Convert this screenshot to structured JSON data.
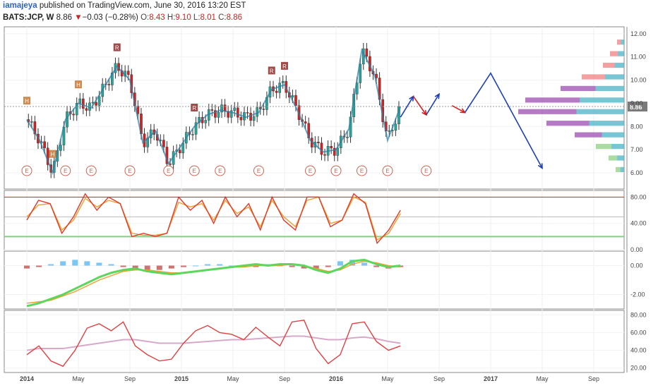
{
  "header": {
    "author": "iamajeya",
    "published_text": "published on TradingView.com, June 30, 2016 13:20 EST",
    "symbol": "BATS:JCP, W",
    "price": "8.86",
    "change_arrow": "▼",
    "change": "−0.03 (−0.28%)",
    "open_label": "O:",
    "open": "8.43",
    "high_label": "H:",
    "high": "9.10",
    "low_label": "L:",
    "low": "8.01",
    "close_label": "C:",
    "close": "8.86"
  },
  "colors": {
    "up": "#26a69a",
    "down": "#d62020",
    "projection_blue": "#1f3fb8",
    "projection_red": "#d62020",
    "volume_profile_purple": "#9b4fb0",
    "volume_profile_teal": "#4bb3c4",
    "volume_profile_pink": "#f08080",
    "volume_profile_green": "#8ed081",
    "stoch_k": "#e03a2a",
    "stoch_d": "#f0a030",
    "band_upper": "#d62020",
    "band_lower": "#7cd47c"
  },
  "chart_data": [
    {
      "type": "candlestick",
      "pane": "price",
      "symbol": "BATS:JCP",
      "interval": "W",
      "x_ticks": [
        "2014",
        "May",
        "Sep",
        "2015",
        "May",
        "Sep",
        "2016",
        "May",
        "Sep",
        "2017",
        "May",
        "Sep"
      ],
      "ylim": [
        5.3,
        12.3
      ],
      "y_ticks": [
        6.0,
        7.0,
        8.0,
        9.0,
        10.0,
        11.0,
        12.0
      ],
      "last_price": 8.86,
      "close_path": [
        [
          "2014-01",
          8.3
        ],
        [
          "2014-02",
          7.4
        ],
        [
          "2014-03",
          6.0
        ],
        [
          "2014-04",
          8.3
        ],
        [
          "2014-05",
          9.0
        ],
        [
          "2014-06",
          8.8
        ],
        [
          "2014-07",
          9.7
        ],
        [
          "2014-08",
          10.6
        ],
        [
          "2014-09",
          10.0
        ],
        [
          "2014-10",
          7.3
        ],
        [
          "2014-11",
          7.8
        ],
        [
          "2014-12",
          6.4
        ],
        [
          "2015-01",
          7.2
        ],
        [
          "2015-02",
          8.0
        ],
        [
          "2015-03",
          8.5
        ],
        [
          "2015-04",
          8.7
        ],
        [
          "2015-05",
          8.6
        ],
        [
          "2015-06",
          8.4
        ],
        [
          "2015-07",
          8.6
        ],
        [
          "2015-08",
          9.6
        ],
        [
          "2015-09",
          9.8
        ],
        [
          "2015-10",
          8.7
        ],
        [
          "2015-11",
          7.4
        ],
        [
          "2015-12",
          6.9
        ],
        [
          "2016-01",
          7.0
        ],
        [
          "2016-02",
          7.9
        ],
        [
          "2016-03",
          11.3
        ],
        [
          "2016-04",
          10.2
        ],
        [
          "2016-05",
          7.4
        ],
        [
          "2016-06",
          8.86
        ]
      ],
      "markers": {
        "R": [
          "2014-08",
          "2015-02",
          "2015-08",
          "2015-09"
        ],
        "H": [
          "2014-01",
          "2014-03",
          "2014-05"
        ],
        "E": [
          "2014-01",
          "2014-04",
          "2014-06",
          "2014-09",
          "2014-12",
          "2015-02",
          "2015-04",
          "2015-07",
          "2015-11",
          "2016-01",
          "2016-03",
          "2016-05",
          "2016-08"
        ]
      },
      "projection": [
        {
          "color": "blue",
          "points": [
            [
              "2016-06",
              8.4
            ],
            [
              "2016-07",
              9.3
            ]
          ]
        },
        {
          "color": "red",
          "points": [
            [
              "2016-07",
              9.3
            ],
            [
              "2016-08",
              8.5
            ]
          ]
        },
        {
          "color": "blue",
          "points": [
            [
              "2016-08",
              8.5
            ],
            [
              "2016-09",
              9.4
            ]
          ]
        },
        {
          "color": "red",
          "points": [
            [
              "2016-10",
              8.9
            ],
            [
              "2016-11",
              8.6
            ]
          ]
        },
        {
          "color": "blue",
          "points": [
            [
              "2016-11",
              8.6
            ],
            [
              "2017-01",
              10.3
            ],
            [
              "2017-05",
              6.2
            ]
          ]
        }
      ]
    },
    {
      "type": "line",
      "pane": "stochastic",
      "ylim": [
        0,
        90
      ],
      "y_ticks": [
        0.0,
        40.0,
        80.0
      ],
      "bands": {
        "upper": 80,
        "middle": 50,
        "lower": 20
      },
      "series": [
        {
          "values": [
            45,
            75,
            70,
            25,
            50,
            85,
            60,
            80,
            70,
            20,
            25,
            20,
            25,
            80,
            60,
            75,
            40,
            80,
            50,
            70,
            30,
            80,
            45,
            30,
            80,
            80,
            35,
            45,
            85,
            70,
            10,
            30,
            60
          ]
        },
        {
          "values": [
            50,
            68,
            70,
            30,
            45,
            78,
            65,
            75,
            70,
            25,
            22,
            22,
            25,
            72,
            65,
            70,
            45,
            75,
            55,
            65,
            35,
            75,
            50,
            35,
            75,
            80,
            40,
            45,
            80,
            72,
            15,
            25,
            55
          ]
        }
      ]
    },
    {
      "type": "bar",
      "pane": "macd",
      "ylim": [
        -3,
        1
      ],
      "y_ticks": [
        -2.0,
        0.0
      ],
      "series": [
        {
          "values": [
            -0.2,
            -0.1,
            0.1,
            0.3,
            0.4,
            0.3,
            0.2,
            0.1,
            -0.1,
            -0.3,
            -0.4,
            -0.3,
            -0.2,
            -0.1,
            0.0,
            0.1,
            0.1,
            0.0,
            -0.1,
            -0.1,
            0.1,
            0.0,
            -0.1,
            -0.2,
            -0.2,
            -0.1,
            0.3,
            0.4,
            0.2,
            -0.1,
            -0.2,
            -0.1
          ]
        },
        {
          "values": [
            -2.8,
            -2.6,
            -2.3,
            -2.0,
            -1.6,
            -1.2,
            -0.8,
            -0.5,
            -0.3,
            -0.2,
            -0.4,
            -0.5,
            -0.6,
            -0.5,
            -0.4,
            -0.3,
            -0.2,
            -0.1,
            0.0,
            0.1,
            0.0,
            0.1,
            0.1,
            0.0,
            -0.3,
            -0.5,
            -0.2,
            0.3,
            0.4,
            0.1,
            -0.1,
            0.0
          ]
        },
        {
          "values": [
            -2.6,
            -2.5,
            -2.4,
            -2.1,
            -1.8,
            -1.4,
            -1.0,
            -0.7,
            -0.4,
            -0.3,
            -0.3,
            -0.4,
            -0.5,
            -0.5,
            -0.4,
            -0.3,
            -0.2,
            -0.1,
            -0.1,
            0.0,
            0.0,
            0.0,
            0.1,
            0.0,
            -0.2,
            -0.4,
            -0.3,
            0.1,
            0.3,
            0.2,
            0.0,
            -0.1
          ]
        }
      ]
    },
    {
      "type": "line",
      "pane": "oscillator",
      "ylim": [
        15,
        85
      ],
      "y_ticks": [
        20.0,
        40.0,
        60.0,
        80.0
      ],
      "series": [
        {
          "values": [
            35,
            45,
            28,
            22,
            40,
            65,
            70,
            62,
            72,
            45,
            35,
            28,
            30,
            48,
            62,
            68,
            60,
            58,
            52,
            66,
            55,
            45,
            72,
            74,
            42,
            25,
            35,
            70,
            72,
            50,
            40,
            45
          ]
        },
        {
          "values": [
            40,
            42,
            42,
            42,
            44,
            46,
            48,
            50,
            52,
            52,
            50,
            48,
            48,
            48,
            49,
            50,
            51,
            52,
            52,
            53,
            54,
            55,
            56,
            56,
            54,
            52,
            52,
            54,
            55,
            53,
            50,
            48
          ]
        }
      ]
    }
  ]
}
